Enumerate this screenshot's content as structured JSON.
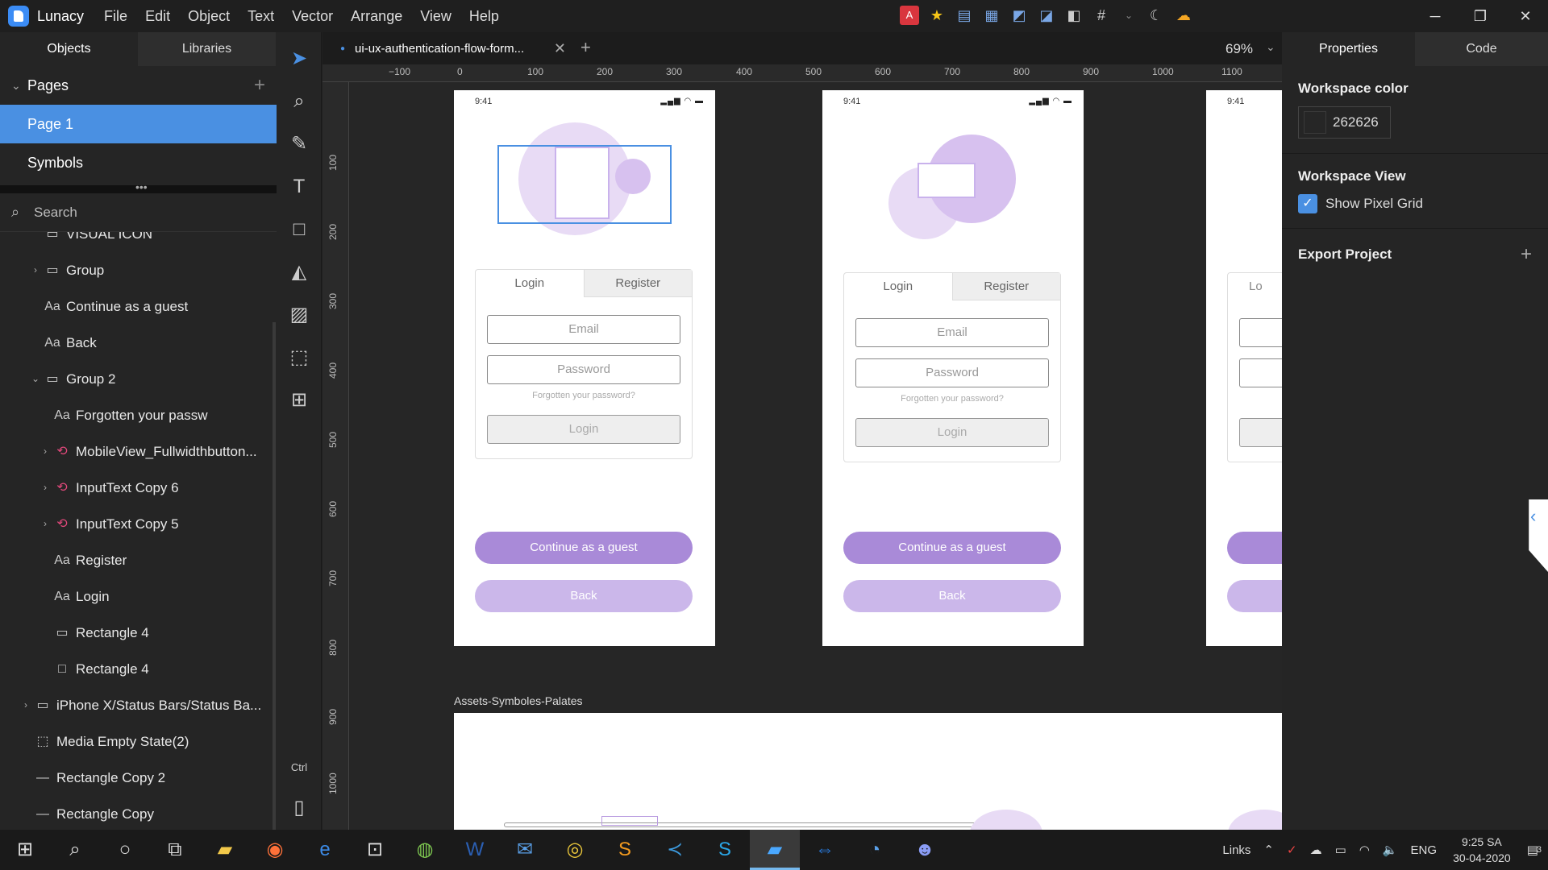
{
  "app": {
    "name": "Lunacy"
  },
  "menu": [
    "File",
    "Edit",
    "Object",
    "Text",
    "Vector",
    "Arrange",
    "View",
    "Help"
  ],
  "left_panel": {
    "tabs": [
      "Objects",
      "Libraries"
    ],
    "pages_header": "Pages",
    "pages": [
      "Page 1",
      "Symbols"
    ],
    "search_placeholder": "Search",
    "layers": [
      {
        "label": "VISUAL ICON",
        "icon": "folder-icon",
        "indent": 0,
        "arrow": ""
      },
      {
        "label": "Group",
        "icon": "folder-icon",
        "indent": 0,
        "arrow": "›"
      },
      {
        "label": "Continue as a guest",
        "icon": "text-icon",
        "indent": 0,
        "arrow": ""
      },
      {
        "label": "Back",
        "icon": "text-icon",
        "indent": 0,
        "arrow": ""
      },
      {
        "label": "Group 2",
        "icon": "folder-icon",
        "indent": 0,
        "arrow": "⌄"
      },
      {
        "label": "Forgotten your passw",
        "icon": "text-icon",
        "indent": 1,
        "arrow": ""
      },
      {
        "label": "MobileView_Fullwidthbutton...",
        "icon": "component-icon",
        "indent": 1,
        "arrow": "›"
      },
      {
        "label": "InputText Copy 6",
        "icon": "component-icon",
        "indent": 1,
        "arrow": "›"
      },
      {
        "label": "InputText Copy 5",
        "icon": "component-icon",
        "indent": 1,
        "arrow": "›"
      },
      {
        "label": "Register",
        "icon": "text-icon",
        "indent": 1,
        "arrow": ""
      },
      {
        "label": "Login",
        "icon": "text-icon",
        "indent": 1,
        "arrow": ""
      },
      {
        "label": "Rectangle 4",
        "icon": "folder-icon",
        "indent": 1,
        "arrow": ""
      },
      {
        "label": "Rectangle 4",
        "icon": "rectangle-icon",
        "indent": 1,
        "arrow": ""
      },
      {
        "label": "iPhone X/Status Bars/Status Ba...",
        "icon": "folder-icon",
        "indent": -1,
        "arrow": "›"
      },
      {
        "label": "Media Empty State(2)",
        "icon": "image-icon",
        "indent": -1,
        "arrow": ""
      },
      {
        "label": "Rectangle Copy 2",
        "icon": "line-icon",
        "indent": -1,
        "arrow": ""
      },
      {
        "label": "Rectangle Copy",
        "icon": "line-icon",
        "indent": -1,
        "arrow": ""
      }
    ]
  },
  "document": {
    "tab_title": "ui-ux-authentication-flow-form...",
    "zoom": "69%"
  },
  "ruler": {
    "h_ticks": [
      "−100",
      "0",
      "100",
      "200",
      "300",
      "400",
      "500",
      "600",
      "700",
      "800",
      "900",
      "1000",
      "1100"
    ],
    "v_ticks": [
      "100",
      "200",
      "300",
      "400",
      "500",
      "600",
      "700",
      "800",
      "900",
      "1000"
    ]
  },
  "artboards": {
    "status_time": "9:41",
    "tabs": [
      "Login",
      "Register"
    ],
    "email": "Email",
    "password": "Password",
    "forgot": "Forgotten your password?",
    "login_button": "Login",
    "guest_button": "Continue as a guest",
    "back_button": "Back",
    "partial_tab": "Lo",
    "assets_label": "Assets-Symboles-Palates"
  },
  "right_panel": {
    "tabs": [
      "Properties",
      "Code"
    ],
    "workspace_color_title": "Workspace color",
    "workspace_color": "262626",
    "workspace_view_title": "Workspace View",
    "show_pixel_grid": "Show Pixel Grid",
    "export_title": "Export Project"
  },
  "taskbar": {
    "links": "Links",
    "language": "ENG",
    "time": "9:25 SA",
    "date": "30-04-2020",
    "notifications": "3"
  },
  "colors": {
    "accent": "#4a90e2",
    "primary_purple": "#a98ad8",
    "light_purple": "#cbb7ea",
    "workspace": "#262626"
  }
}
